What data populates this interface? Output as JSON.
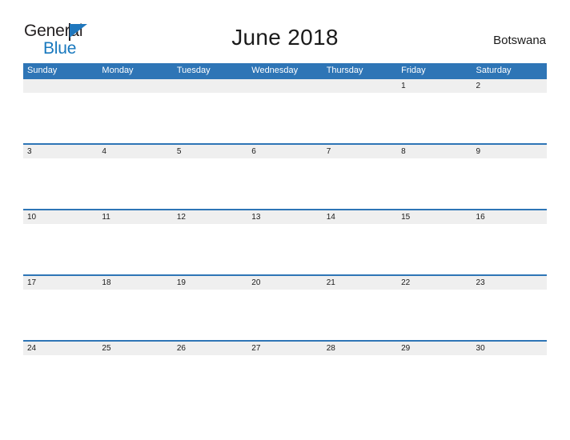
{
  "brand": {
    "name_part1": "General",
    "name_part2": "Blue",
    "flag_icon": "blue-flag-icon",
    "colors": {
      "text_dark": "#231f20",
      "blue": "#1878be"
    }
  },
  "header": {
    "title": "June 2018",
    "region": "Botswana"
  },
  "calendar": {
    "month": "June",
    "year": "2018",
    "header_color": "#2e75b6",
    "row_band_color": "#efefef",
    "weekdays": [
      "Sunday",
      "Monday",
      "Tuesday",
      "Wednesday",
      "Thursday",
      "Friday",
      "Saturday"
    ],
    "weeks": [
      [
        "",
        "",
        "",
        "",
        "",
        "1",
        "2"
      ],
      [
        "3",
        "4",
        "5",
        "6",
        "7",
        "8",
        "9"
      ],
      [
        "10",
        "11",
        "12",
        "13",
        "14",
        "15",
        "16"
      ],
      [
        "17",
        "18",
        "19",
        "20",
        "21",
        "22",
        "23"
      ],
      [
        "24",
        "25",
        "26",
        "27",
        "28",
        "29",
        "30"
      ]
    ]
  }
}
